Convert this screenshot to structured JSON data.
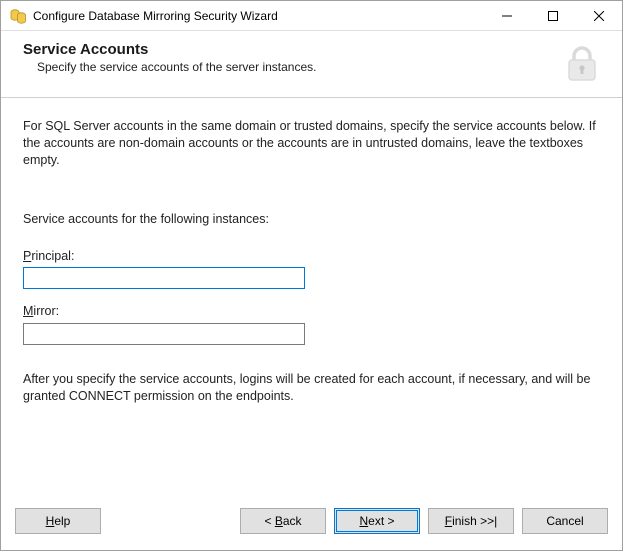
{
  "window": {
    "title": "Configure Database Mirroring Security Wizard"
  },
  "header": {
    "title": "Service Accounts",
    "subtitle": "Specify the service accounts of the server instances."
  },
  "content": {
    "intro": "For SQL Server accounts in the same domain or trusted domains, specify the service accounts below. If the accounts are non-domain accounts or the accounts are in untrusted domains, leave the textboxes empty.",
    "instances_label": "Service accounts for the following instances:",
    "principal": {
      "prefix": "P",
      "suffix": "rincipal:",
      "value": ""
    },
    "mirror": {
      "prefix": "M",
      "suffix": "irror:",
      "value": ""
    },
    "after": "After you specify the service accounts, logins will be created for each account, if necessary, and will be granted CONNECT permission on the endpoints."
  },
  "buttons": {
    "help_u": "H",
    "help_rest": "elp",
    "back_pre": "< ",
    "back_u": "B",
    "back_rest": "ack",
    "next_u": "N",
    "next_rest": "ext >",
    "finish_u": "F",
    "finish_rest": "inish >>|",
    "cancel": "Cancel"
  }
}
